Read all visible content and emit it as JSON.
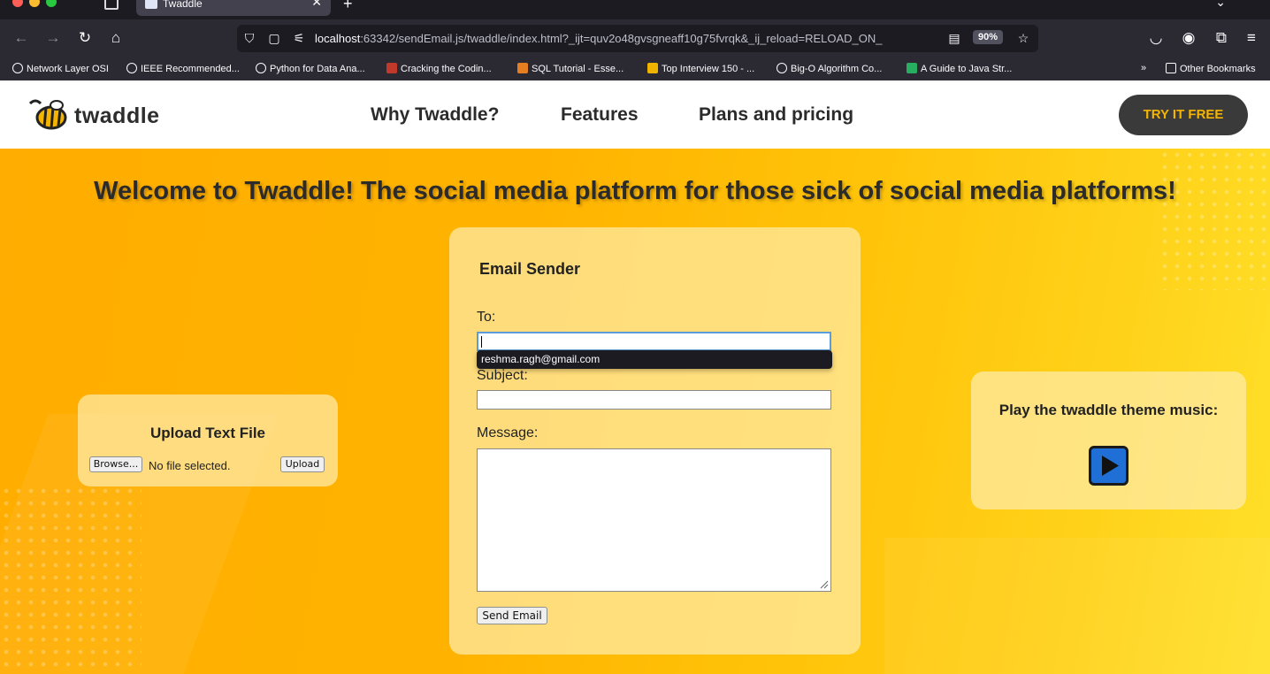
{
  "browser": {
    "tab_title": "Twaddle",
    "url_host": "localhost",
    "url_rest": ":63342/sendEmail.js/twaddle/index.html?_ijt=quv2o48gvsgneaff10g75fvrqk&_ij_reload=RELOAD_ON_",
    "zoom": "90%",
    "bookmarks": [
      {
        "label": "Network Layer OSI"
      },
      {
        "label": "IEEE Recommended..."
      },
      {
        "label": "Python for Data Ana..."
      },
      {
        "label": "Cracking the Codin..."
      },
      {
        "label": "SQL Tutorial - Esse..."
      },
      {
        "label": "Top Interview 150 - ..."
      },
      {
        "label": "Big-O Algorithm Co..."
      },
      {
        "label": "A Guide to Java Str..."
      }
    ],
    "other_bookmarks": "Other Bookmarks"
  },
  "site": {
    "logo_text": "twaddle",
    "nav": [
      "Why Twaddle?",
      "Features",
      "Plans and pricing"
    ],
    "cta": "TRY IT FREE",
    "headline": "Welcome to Twaddle! The social media platform for those sick of social media platforms!",
    "upload": {
      "title": "Upload Text File",
      "browse": "Browse...",
      "no_file": "No file selected.",
      "upload": "Upload"
    },
    "email": {
      "title": "Email Sender",
      "to_label": "To:",
      "autocomplete": "reshma.ragh@gmail.com",
      "subject_label": "Subject:",
      "message_label": "Message:",
      "send": "Send Email"
    },
    "music": {
      "title": "Play the twaddle theme music:"
    }
  },
  "colors": {
    "brand_yellow": "#ffb300",
    "cta_bg": "#3a3a3a",
    "cta_text": "#f5b400",
    "play_button": "#1f6fd6"
  }
}
